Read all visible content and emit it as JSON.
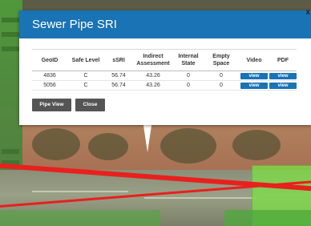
{
  "popup": {
    "title": "Sewer Pipe SRI",
    "close_glyph": "x",
    "table": {
      "columns": [
        "GeoID",
        "Safe Level",
        "sSRI",
        "Indirect Assessment",
        "Internal State",
        "Empty Space",
        "Video",
        "PDF"
      ],
      "rows": [
        {
          "geoid": "4836",
          "safe_level": "C",
          "ssri": "56.74",
          "indirect": "43.26",
          "internal": "0",
          "empty": "0",
          "video": "view",
          "pdf": "view"
        },
        {
          "geoid": "5056",
          "safe_level": "C",
          "ssri": "56.74",
          "indirect": "43.26",
          "internal": "0",
          "empty": "0",
          "video": "view",
          "pdf": "view"
        }
      ]
    },
    "buttons": {
      "pipe_view": "Pipe View",
      "close": "Close"
    }
  },
  "colors": {
    "header": "#1a73b4",
    "view_button": "#1a73b4",
    "action_button": "#555555",
    "pipe_line": "#e8201e"
  }
}
